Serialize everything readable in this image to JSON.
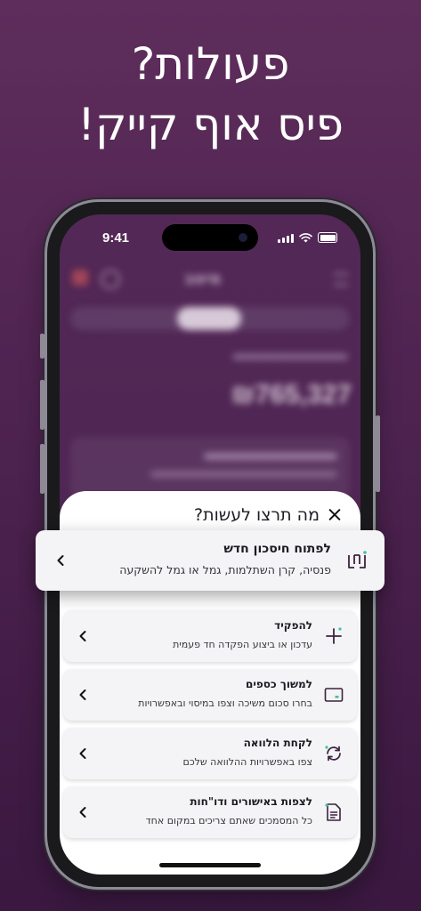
{
  "headline": {
    "line1": "פעולות?",
    "line2": "פיס אוף קייק!"
  },
  "status_bar": {
    "time": "9:41"
  },
  "background_app": {
    "brand": "מיטב",
    "balance": "₪765,327"
  },
  "sheet": {
    "title": "מה תרצו לעשות?",
    "options": [
      {
        "title": "לפתוח חיסכון חדש",
        "subtitle": "פנסיה, קרן השתלמות, גמל או גמל להשקעה",
        "icon": "meitav-logo-icon"
      },
      {
        "title": "להפקיד",
        "subtitle": "עדכון או ביצוע הפקדה חד פעמית",
        "icon": "plus-icon"
      },
      {
        "title": "למשוך כספים",
        "subtitle": "בחרו סכום משיכה וצפו במיסוי ובאפשרויות",
        "icon": "wallet-icon"
      },
      {
        "title": "לקחת הלוואה",
        "subtitle": "צפו באפשרויות ההלוואה שלכם",
        "icon": "refresh-icon"
      },
      {
        "title": "לצפות באישורים ודו\"חות",
        "subtitle": "כל המסמכים שאתם צריכים במקום אחד",
        "icon": "document-icon"
      }
    ]
  },
  "colors": {
    "accent": "#3fc2a6",
    "icon_dark": "#3b2340",
    "background": "#4e2350"
  }
}
